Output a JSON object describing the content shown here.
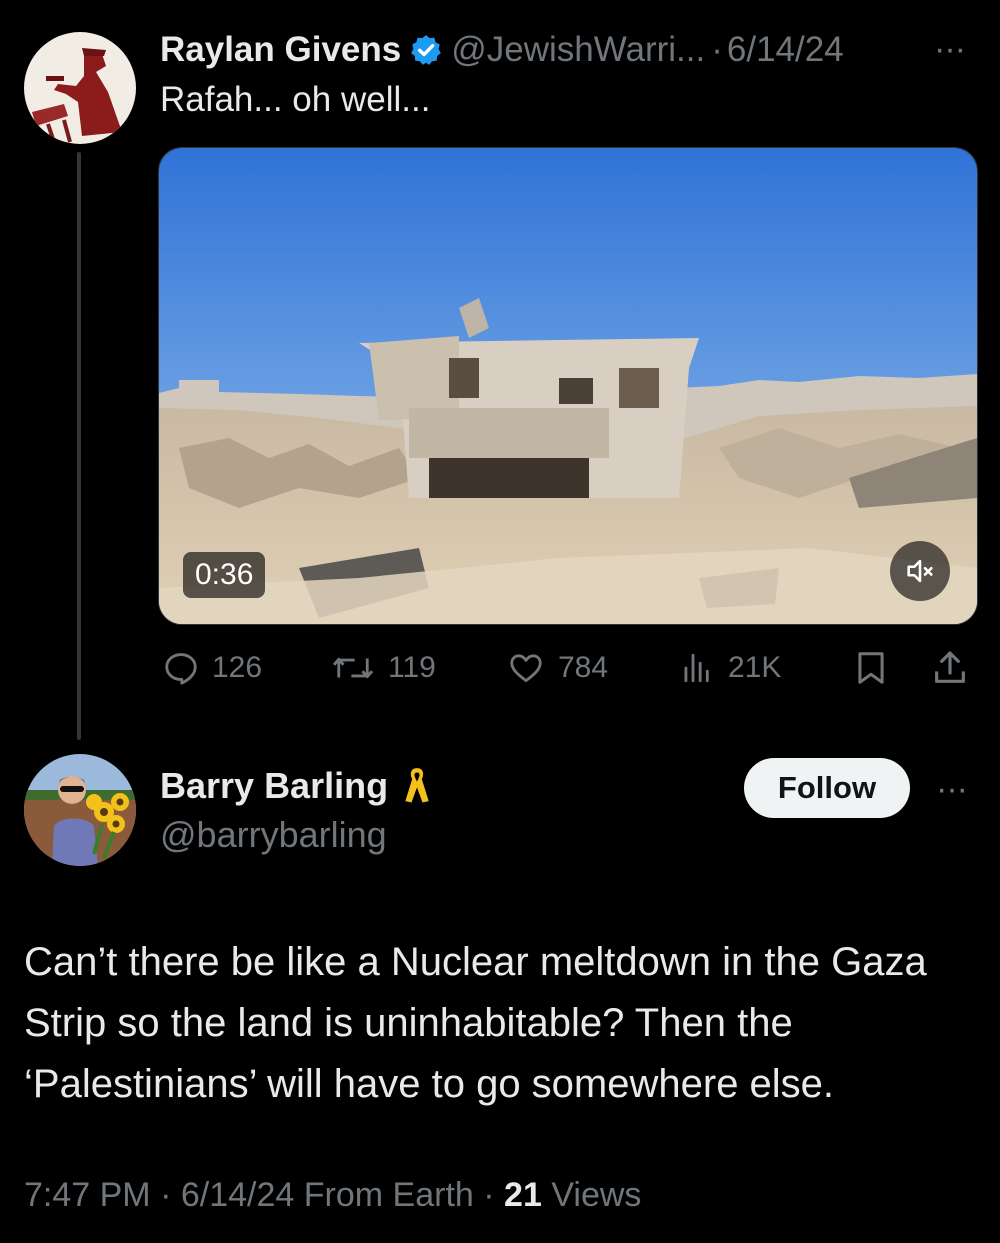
{
  "parent_tweet": {
    "author_name": "Raylan Givens",
    "handle": "@JewishWarri...",
    "separator": "·",
    "date": "6/14/24",
    "more": "···",
    "text": "Rafah... oh well...",
    "video": {
      "duration": "0:36"
    },
    "stats": {
      "replies": "126",
      "reposts": "119",
      "likes": "784",
      "views": "21K"
    }
  },
  "reply_tweet": {
    "author_name": "Barry Barling",
    "handle": "@barrybarling",
    "follow_label": "Follow",
    "more": "···",
    "text": "Can’t there be like a Nuclear meltdown in the Gaza Strip so the land is uninhabitable? Then the ‘Palestinians’ will have to go somewhere else.",
    "time": "7:47 PM",
    "date": "6/14/24",
    "source": "From Earth",
    "dot": "·",
    "views_count": "21",
    "views_label": "Views"
  },
  "colors": {
    "background": "#000000",
    "text_primary": "#e7e9ea",
    "text_secondary": "#71767b",
    "verified_badge": "#1d9bf0",
    "ribbon": "#f4c01e"
  },
  "icons": [
    "verified-badge-icon",
    "reply-icon",
    "repost-icon",
    "like-icon",
    "views-icon",
    "bookmark-icon",
    "share-icon",
    "mute-icon",
    "yellow-ribbon-icon",
    "more-icon"
  ]
}
